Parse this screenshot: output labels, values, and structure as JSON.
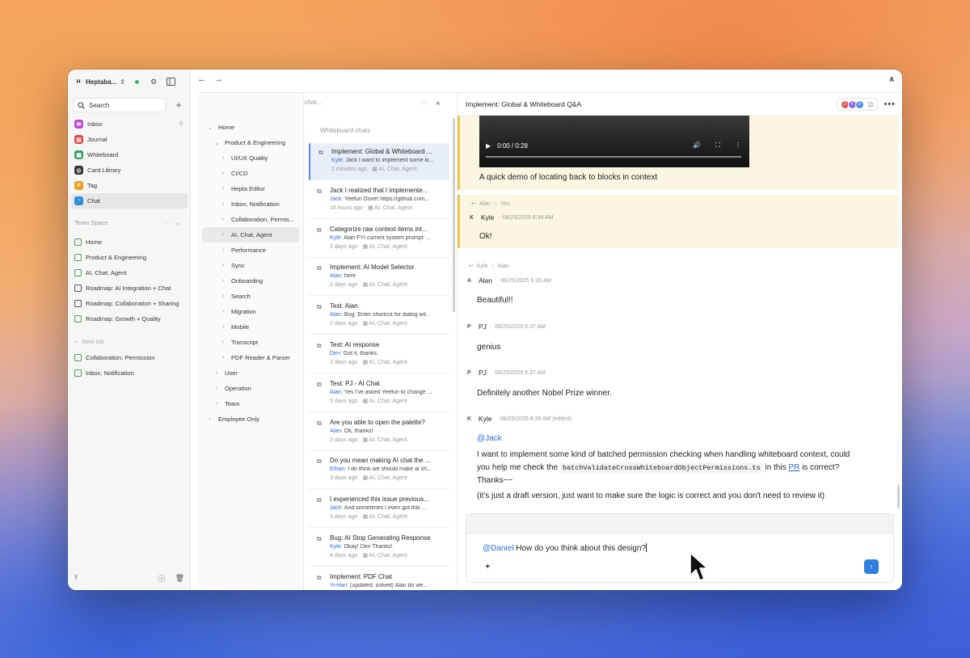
{
  "colors": {
    "accent": "#2f7fe0",
    "highlight": "#fbf6e2",
    "highlight_bar": "#e8c84a",
    "mention": "#2f6bd8"
  },
  "sidebar": {
    "workspace": "Heptaba...",
    "workspace_initial": "H",
    "search": "Search",
    "items": [
      {
        "label": "Inbox",
        "count": "0",
        "color": "#c04bd6",
        "glyph": "✉"
      },
      {
        "label": "Journal",
        "color": "#e04848",
        "glyph": "▤"
      },
      {
        "label": "Whiteboard",
        "color": "#3a9f6d",
        "glyph": "▦"
      },
      {
        "label": "Card Library",
        "color": "#333333",
        "glyph": "◎"
      },
      {
        "label": "Tag",
        "color": "#f0a020",
        "glyph": "#"
      },
      {
        "label": "Chat",
        "color": "#2f8fd8",
        "glyph": "◔"
      }
    ],
    "team_space": "Team Space",
    "team_items": [
      {
        "label": "Home",
        "icon": "board"
      },
      {
        "label": "Product & Engineering",
        "icon": "board"
      },
      {
        "label": "AI, Chat, Agent",
        "icon": "board"
      },
      {
        "label": "Roadmap: AI Integration + Chat",
        "icon": "doc"
      },
      {
        "label": "Roadmap: Collaboration + Sharing",
        "icon": "doc"
      },
      {
        "label": "Roadmap: Growth + Quality",
        "icon": "board"
      }
    ],
    "new_tab": "New tab",
    "recent_items": [
      {
        "label": "Collaboration, Permission"
      },
      {
        "label": "Inbox, Notification"
      }
    ]
  },
  "topbar": {
    "user_initial": "A"
  },
  "tree": {
    "rows": [
      {
        "label": "Home",
        "depth": 0,
        "chev": "⌄"
      },
      {
        "label": "Product & Engineering",
        "depth": 1,
        "chev": "⌄"
      },
      {
        "label": "UI/UX Quality",
        "depth": 2,
        "chev": "›"
      },
      {
        "label": "CI/CD",
        "depth": 2,
        "chev": "›"
      },
      {
        "label": "Hepta Editor",
        "depth": 2,
        "chev": "›"
      },
      {
        "label": "Inbox, Notification",
        "depth": 2,
        "chev": "›"
      },
      {
        "label": "Collaboration, Permis...",
        "depth": 2,
        "chev": "›"
      },
      {
        "label": "AI, Chat, Agent",
        "depth": 2,
        "chev": "›",
        "active": true
      },
      {
        "label": "Performance",
        "depth": 2,
        "chev": "›"
      },
      {
        "label": "Sync",
        "depth": 2,
        "chev": "›"
      },
      {
        "label": "Onboarding",
        "depth": 2,
        "chev": "›"
      },
      {
        "label": "Search",
        "depth": 2,
        "chev": "›"
      },
      {
        "label": "Migration",
        "depth": 2,
        "chev": "›"
      },
      {
        "label": "Mobile",
        "depth": 2,
        "chev": "›"
      },
      {
        "label": "Transcript",
        "depth": 2,
        "chev": "›"
      },
      {
        "label": "PDF Reader & Parser",
        "depth": 2,
        "chev": "›"
      },
      {
        "label": "User",
        "depth": 1,
        "chev": "›"
      },
      {
        "label": "Operation",
        "depth": 1,
        "chev": "›"
      },
      {
        "label": "Team",
        "depth": 1,
        "chev": "›"
      },
      {
        "label": "Employee Only",
        "depth": 0,
        "chev": "›"
      }
    ]
  },
  "chatlist": {
    "search_placeholder": "Find a chat...",
    "title": "Whiteboard chats",
    "items": [
      {
        "title": "Implement: Global & Whiteboard ...",
        "who": "Kyle:",
        "preview": "Jack I want to implement some ki...",
        "time": "2 minutes ago",
        "tag": "AI, Chat, Agent",
        "active": true
      },
      {
        "title": "Jack I realized that I implemente...",
        "who": "Jack:",
        "preview": "Yeefun Done! https://github.com...",
        "time": "16 hours ago",
        "tag": "AI, Chat, Agent"
      },
      {
        "title": "Categorize raw context items int...",
        "who": "Kyle:",
        "preview": "Alan FYI current system prompt: ...",
        "time": "2 days ago",
        "tag": "AI, Chat, Agent"
      },
      {
        "title": "Implement: AI Model Selector",
        "who": "Alan:",
        "preview": "here",
        "time": "2 days ago",
        "tag": "AI, Chat, Agent"
      },
      {
        "title": "Test: Alan",
        "who": "Alan:",
        "preview": "Bug: Enter shortcut for dialog wil...",
        "time": "2 days ago",
        "tag": "AI, Chat, Agent"
      },
      {
        "title": "Test: AI response",
        "who": "Den:",
        "preview": "Got it, thanks.",
        "time": "2 days ago",
        "tag": "AI, Chat, Agent"
      },
      {
        "title": "Test: PJ - AI Chat",
        "who": "Alan:",
        "preview": "Yes I've asked Yeefun to change ...",
        "time": "3 days ago",
        "tag": "AI, Chat, Agent"
      },
      {
        "title": "Are you able to open the palette?",
        "who": "Alan:",
        "preview": "Ok, thanks!",
        "time": "3 days ago",
        "tag": "AI, Chat, Agent"
      },
      {
        "title": "Do you mean making AI chat the ...",
        "who": "Ethan:",
        "preview": "I do think we should make ai ch...",
        "time": "3 days ago",
        "tag": "AI, Chat, Agent"
      },
      {
        "title": "I experienced this issue previous...",
        "who": "Jack:",
        "preview": "And sometimes I even got this ...",
        "time": "3 days ago",
        "tag": "AI, Chat, Agent"
      },
      {
        "title": "Bug: AI Stop Generating Response",
        "who": "Kyle:",
        "preview": "Okay! Den Thanks!",
        "time": "4 days ago",
        "tag": "AI, Chat, Agent"
      },
      {
        "title": "Implement: PDF Chat",
        "who": "Yi-Han:",
        "preview": "(updated: solved) Alan do we...",
        "time": "",
        "tag": ""
      }
    ]
  },
  "chat": {
    "title": "Implement: Global & Whiteboard Q&A",
    "members": [
      {
        "initial": "J",
        "color": "#e05a5a"
      },
      {
        "initial": "Y",
        "color": "#8a6be0"
      },
      {
        "initial": "D",
        "color": "#4a8fe0"
      }
    ],
    "member_count": "11",
    "video_time": "0:00 / 0:28",
    "video_caption": "A quick demo of locating back to blocks in context",
    "m1_reply": "Alan",
    "m1_reply_text": "Yes.",
    "m1_avatar": "K",
    "m1_name": "Kyle",
    "m1_time": "· 06/25/2025 6:34 AM",
    "m1_text": "Ok!",
    "m2_reply_a": "Kyle",
    "m2_reply_b": "Alan",
    "m2_avatar": "A",
    "m2_name": "Alan",
    "m2_time": "· 06/25/2025 6:35 AM",
    "m2_text": "Beautiful!!",
    "m3_avatar": "P",
    "m3_name": "PJ",
    "m3_time": "· 06/25/2025 6:37 AM",
    "m3_text": "genius",
    "m4_avatar": "P",
    "m4_name": "PJ",
    "m4_time": "· 06/25/2025 6:37 AM",
    "m4_text": "Definitely another Nobel Prize winner.",
    "m5_avatar": "K",
    "m5_name": "Kyle",
    "m5_time": "· 06/25/2025 8:39 AM (edited)",
    "m5_mention": "@Jack",
    "m5_line1": "I want to implement some kind of batched permission checking when handling whiteboard context, could",
    "m5_line2a": "you help me check the",
    "m5_code": "batchValidateCrossWhiteboardObjectPermissions.ts",
    "m5_line2b": "in this",
    "m5_link": "PR",
    "m5_line2c": "is correct?",
    "m5_line3": "Thanks~~",
    "m5_line4": "(it's just a draft version, just want to make sure the logic is correct and you don't need to review it)",
    "composer_mention": "@Daniel",
    "composer_text": "How do you think about this design?"
  }
}
